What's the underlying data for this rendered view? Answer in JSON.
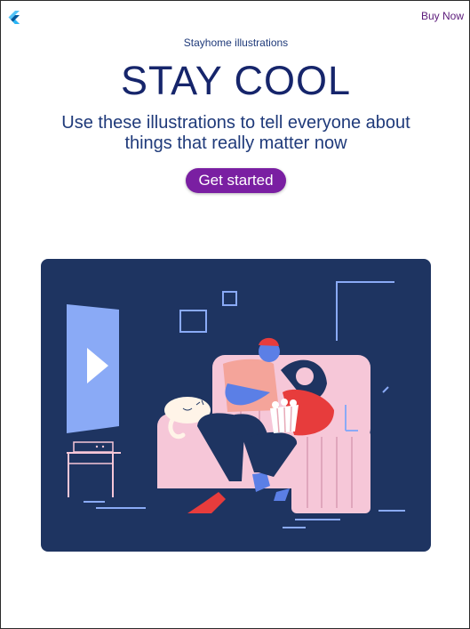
{
  "header": {
    "logo_icon": "flutter-logo-icon",
    "buy_label": "Buy Now"
  },
  "hero": {
    "eyebrow": "Stayhome illustrations",
    "title": "STAY COOL",
    "subtitle": "Use these illustrations to tell everyone about things that really matter now",
    "cta_label": "Get started"
  },
  "illustration": {
    "icon": "couple-watching-tv-illustration",
    "colors": {
      "background": "#1e3461",
      "sofa": "#f6c7d8",
      "screen": "#8aaaf6",
      "accent_red": "#e73c3c",
      "skin": "#5b7fe6"
    }
  },
  "colors": {
    "accent": "#7a1fa2",
    "heading": "#16256b",
    "text": "#1f3a7a"
  }
}
